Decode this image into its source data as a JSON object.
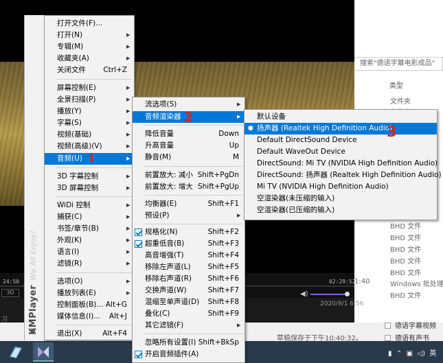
{
  "player": {
    "time_left": "24:50",
    "time_right": "02:29:52",
    "btn_3d": "3D"
  },
  "explorer": {
    "search_placeholder": "搜索\"德语字幕电影成品\"",
    "col_type": "类型",
    "rows": [
      {
        "text": "文件夹"
      },
      {
        "text": "文件夹"
      },
      {
        "text": "BHD 文件"
      },
      {
        "text": "BHD 文件"
      },
      {
        "text": "BHD 文件"
      },
      {
        "text": "BHD 文件"
      },
      {
        "text": "BHD 文件"
      },
      {
        "text": "Windows 批处理..."
      },
      {
        "text": "BHD 文件"
      }
    ],
    "time_fragment": "1:40",
    "date_fragment": "2020/9/1 6:56",
    "check_rows": [
      "德语字幕视频",
      "德语有声书"
    ]
  },
  "status": {
    "draft_saved": "草稿保存于下午10:40:32。",
    "left_fragment": "习"
  },
  "kmplayer": {
    "logo": "KMPlayer",
    "slogan": "We All Enjoy!"
  },
  "main_menu": [
    {
      "label": "打开文件(F)...",
      "shortcut": "",
      "submenu": false
    },
    {
      "label": "打开(N)",
      "shortcut": "",
      "submenu": true
    },
    {
      "label": "专辑(M)",
      "shortcut": "",
      "submenu": true
    },
    {
      "label": "收藏夹(A)",
      "shortcut": "",
      "submenu": true
    },
    {
      "label": "关闭文件",
      "shortcut": "Ctrl+Z",
      "submenu": false
    },
    {
      "label": "屏幕控制(E)",
      "shortcut": "",
      "submenu": true
    },
    {
      "label": "全景扫描(P)",
      "shortcut": "",
      "submenu": true
    },
    {
      "label": "播放(Y)",
      "shortcut": "",
      "submenu": true
    },
    {
      "label": "字幕(S)",
      "shortcut": "",
      "submenu": true
    },
    {
      "label": "视频(基础)",
      "shortcut": "",
      "submenu": true
    },
    {
      "label": "视频(高级)(V)",
      "shortcut": "",
      "submenu": true
    },
    {
      "label": "音频(U)",
      "shortcut": "",
      "submenu": true
    },
    {
      "label": "3D 字幕控制",
      "shortcut": "",
      "submenu": true
    },
    {
      "label": "3D 屏幕控制",
      "shortcut": "",
      "submenu": true
    },
    {
      "label": "WiDi 控制",
      "shortcut": "",
      "submenu": true
    },
    {
      "label": "捕获(C)",
      "shortcut": "",
      "submenu": true
    },
    {
      "label": "书签/章节(B)",
      "shortcut": "",
      "submenu": true
    },
    {
      "label": "外观(K)",
      "shortcut": "",
      "submenu": true
    },
    {
      "label": "语言(I)",
      "shortcut": "",
      "submenu": true
    },
    {
      "label": "滤镜(R)",
      "shortcut": "",
      "submenu": true
    },
    {
      "label": "选项(O)",
      "shortcut": "",
      "submenu": true
    },
    {
      "label": "播放列表(E)",
      "shortcut": "",
      "submenu": true
    },
    {
      "label": "控制面板(B)...",
      "shortcut": "Alt+G",
      "submenu": false
    },
    {
      "label": "媒体信息(I)...",
      "shortcut": "Alt+J",
      "submenu": false
    },
    {
      "label": "退出(X)",
      "shortcut": "Alt+F4",
      "submenu": false
    }
  ],
  "audio_menu": [
    {
      "label": "流选项(S)",
      "shortcut": "",
      "submenu": true,
      "checked": false
    },
    {
      "label": "音频渲染器",
      "shortcut": "",
      "submenu": true,
      "checked": false
    },
    {
      "label": "降低音量",
      "shortcut": "Down",
      "submenu": false,
      "checked": false
    },
    {
      "label": "升高音量",
      "shortcut": "Up",
      "submenu": false,
      "checked": false
    },
    {
      "label": "静音(M)",
      "shortcut": "M",
      "submenu": false,
      "checked": false
    },
    {
      "label": "前置放大: 减小",
      "shortcut": "Shift+PgDn",
      "submenu": false,
      "checked": false
    },
    {
      "label": "前置放大: 增大",
      "shortcut": "Shift+PgUp",
      "submenu": false,
      "checked": false
    },
    {
      "label": "均衡器(E)",
      "shortcut": "Shift+F1",
      "submenu": false,
      "checked": false
    },
    {
      "label": "预设(P)",
      "shortcut": "",
      "submenu": true,
      "checked": false
    },
    {
      "label": "规格化(N)",
      "shortcut": "Shift+F2",
      "submenu": false,
      "checked": true
    },
    {
      "label": "超重低音(B)",
      "shortcut": "Shift+F3",
      "submenu": false,
      "checked": true
    },
    {
      "label": "高音增强(T)",
      "shortcut": "Shift+F4",
      "submenu": false,
      "checked": false
    },
    {
      "label": "移除左声道(L)",
      "shortcut": "Shift+F5",
      "submenu": false,
      "checked": false
    },
    {
      "label": "移除右声道(R)",
      "shortcut": "Shift+F6",
      "submenu": false,
      "checked": false
    },
    {
      "label": "交换声道(W)",
      "shortcut": "Shift+F7",
      "submenu": false,
      "checked": false
    },
    {
      "label": "混缩至单声道(D)",
      "shortcut": "Shift+F8",
      "submenu": false,
      "checked": false
    },
    {
      "label": "叠化(C)",
      "shortcut": "Shift+F9",
      "submenu": false,
      "checked": false
    },
    {
      "label": "其它滤镜(F)",
      "shortcut": "",
      "submenu": true,
      "checked": false
    },
    {
      "label": "忽略所有设置(I)",
      "shortcut": "Shift+BkSp",
      "submenu": false,
      "checked": false
    },
    {
      "label": "开启音频插件(A)",
      "shortcut": "",
      "submenu": false,
      "checked": true
    }
  ],
  "renderer_menu": [
    {
      "label": "默认设备",
      "selected": false
    },
    {
      "label": "扬声器 (Realtek High Definition Audio)",
      "selected": true
    },
    {
      "label": "Default DirectSound Device",
      "selected": false
    },
    {
      "label": "Default WaveOut Device",
      "selected": false
    },
    {
      "label": "DirectSound: Mi TV (NVIDIA High Definition Audio)",
      "selected": false
    },
    {
      "label": "DirectSound: 扬声器 (Realtek High Definition Audio)",
      "selected": false
    },
    {
      "label": "Mi TV (NVIDIA High Definition Audio)",
      "selected": false
    },
    {
      "label": "空渲染器(未压缩的输入)",
      "selected": false
    },
    {
      "label": "空渲染器(已压缩的输入)",
      "selected": false
    }
  ],
  "annotations": [
    "1",
    "2",
    "3"
  ],
  "colors": {
    "highlight": "#0078d7",
    "annotation": "#e0201a",
    "volume": "#8a5cd6"
  }
}
